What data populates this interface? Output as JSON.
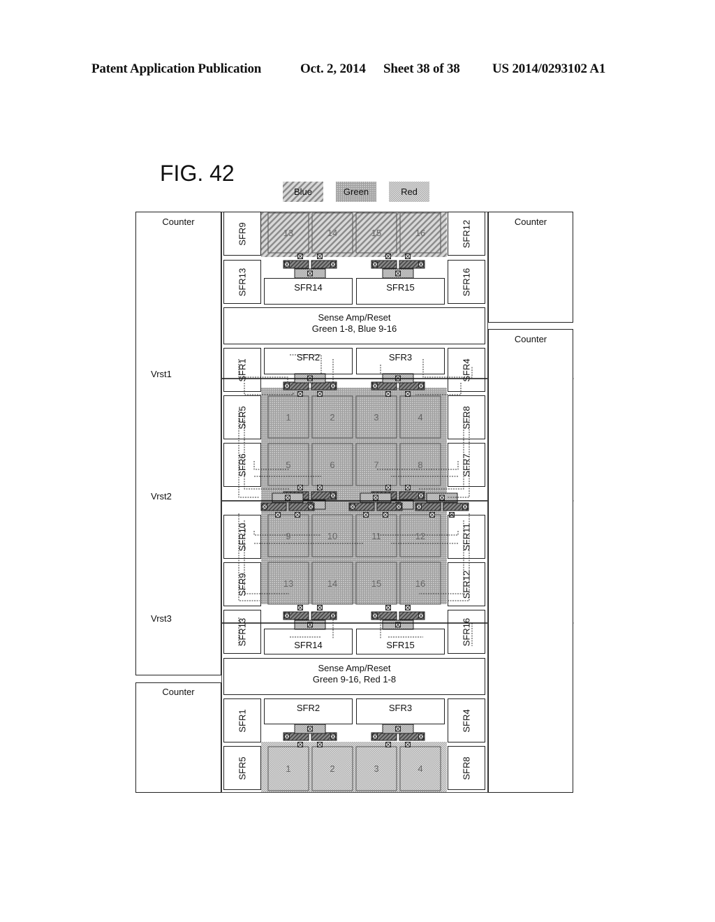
{
  "header": {
    "publication": "Patent Application Publication",
    "date": "Oct. 2, 2014",
    "sheet": "Sheet 38 of 38",
    "number": "US 2014/0293102 A1"
  },
  "figure": {
    "title": "FIG. 42",
    "legend": [
      {
        "label": "Blue",
        "pattern": "diagonal-hatch"
      },
      {
        "label": "Green",
        "pattern": "circle-dots"
      },
      {
        "label": "Red",
        "pattern": "fine-checker"
      }
    ],
    "counters": [
      "Counter",
      "Counter",
      "Counter",
      "Counter"
    ],
    "sense_amps": [
      {
        "line1": "Sense Amp/Reset",
        "line2": "Green 1-8, Blue 9-16"
      },
      {
        "line1": "Sense Amp/Reset",
        "line2": "Green 9-16, Red 1-8"
      }
    ],
    "reset_lines": [
      "Vrst1",
      "Vrst2",
      "Vrst3"
    ],
    "top_block": {
      "color": "Blue",
      "left_sfr": [
        "SFR9",
        "SFR13"
      ],
      "right_sfr": [
        "SFR12",
        "SFR16"
      ],
      "bottom_sfr": [
        "SFR14",
        "SFR15"
      ],
      "pixels": [
        "13",
        "14",
        "15",
        "16"
      ]
    },
    "middle_block": {
      "color": "Green",
      "top_sfr": [
        "SFR2",
        "SFR3"
      ],
      "left_sfr": [
        "SFR1",
        "SFR5",
        "SFR6",
        "SFR10",
        "SFR9",
        "SFR13"
      ],
      "right_sfr": [
        "SFR4",
        "SFR8",
        "SFR7",
        "SFR11",
        "SFR12",
        "SFR16"
      ],
      "bottom_sfr": [
        "SFR14",
        "SFR15"
      ],
      "pixels": [
        "1",
        "2",
        "3",
        "4",
        "5",
        "6",
        "7",
        "8",
        "9",
        "10",
        "11",
        "12",
        "13",
        "14",
        "15",
        "16"
      ]
    },
    "bottom_block": {
      "color": "Red",
      "top_sfr": [
        "SFR2",
        "SFR3"
      ],
      "left_sfr": [
        "SFR1",
        "SFR5"
      ],
      "right_sfr": [
        "SFR4",
        "SFR8"
      ],
      "pixels": [
        "1",
        "2",
        "3",
        "4"
      ]
    }
  }
}
